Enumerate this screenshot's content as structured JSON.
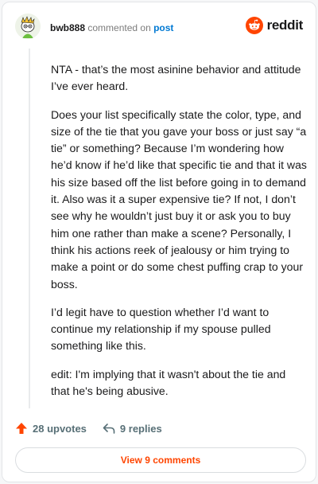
{
  "header": {
    "username": "bwb888",
    "verb": "commented on",
    "target": "post",
    "brand": "reddit"
  },
  "comment": {
    "paragraphs": [
      "NTA - that’s the most asinine behavior and attitude I’ve ever heard.",
      "Does your list specifically state the color, type, and size of the tie that you gave your boss or just say “a tie” or something? Because I’m wondering how he’d know if he’d like that specific tie and that it was his size based off the list before going in to demand it. Also was it a super expensive tie? If not, I don’t see why he wouldn’t just buy it or ask you to buy him one rather than make a scene? Personally, I think his actions reek of jealousy or him trying to make a point or do some chest puffing crap to your boss.",
      "I’d legit have to question whether I’d want to continue my relationship if my spouse pulled something like this.",
      "edit: I'm implying that it wasn't about the tie and that he's being abusive."
    ]
  },
  "footer": {
    "upvotes": "28 upvotes",
    "replies": "9 replies",
    "view_comments": "View 9 comments"
  },
  "colors": {
    "brand": "#ff4500",
    "link": "#0079d3"
  },
  "icons": {
    "avatar": "snoo-avatar",
    "brand": "reddit-logo-icon",
    "upvote": "upvote-arrow-icon",
    "reply": "reply-arrow-icon"
  }
}
